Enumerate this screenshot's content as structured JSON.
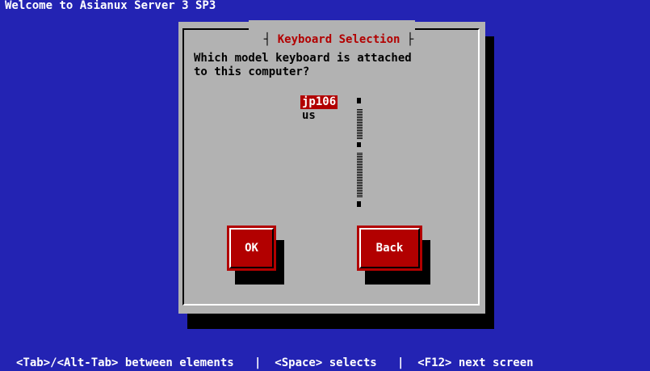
{
  "screen": {
    "title": "Welcome to Asianux Server 3 SP3",
    "footer": "<Tab>/<Alt-Tab> between elements   |  <Space> selects   |  <F12> next screen"
  },
  "dialog": {
    "title": "Keyboard Selection",
    "question": "Which model keyboard is attached\nto this computer?",
    "options": [
      "jp106",
      "us"
    ],
    "selected": "jp106",
    "buttons": {
      "ok": "OK",
      "back": "Back"
    }
  },
  "colors": {
    "background": "#2323b3",
    "dialog": "#b2b2b2",
    "accent": "#b20000",
    "shadow": "#000000"
  }
}
